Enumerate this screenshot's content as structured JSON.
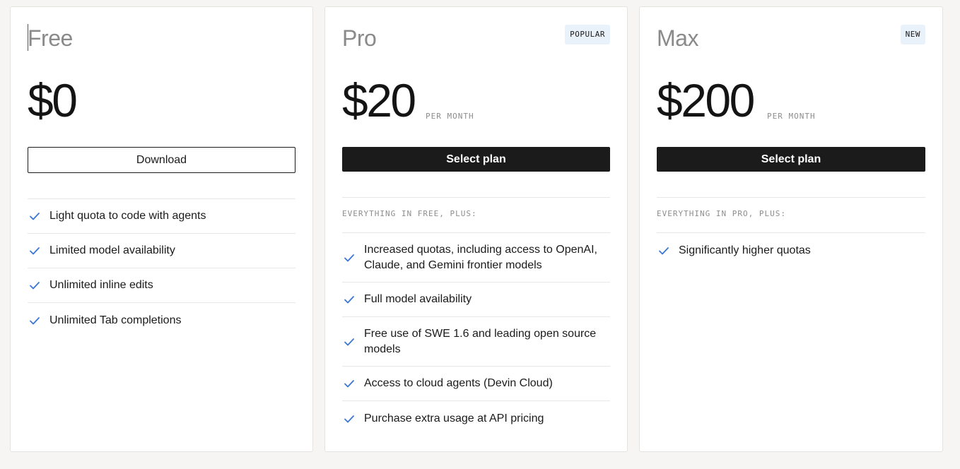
{
  "plans": {
    "free": {
      "name": "Free",
      "price": "$0",
      "button": "Download",
      "features": [
        "Light quota to code with agents",
        "Limited model availability",
        "Unlimited inline edits",
        "Unlimited Tab completions"
      ]
    },
    "pro": {
      "name": "Pro",
      "badge": "POPULAR",
      "price": "$20",
      "period": "PER MONTH",
      "button": "Select plan",
      "everything": "EVERYTHING IN FREE, PLUS:",
      "features": [
        "Increased quotas, including access to OpenAI, Claude, and Gemini frontier models",
        "Full model availability",
        "Free use of SWE 1.6 and leading open source models",
        "Access to cloud agents (Devin Cloud)",
        "Purchase extra usage at API pricing"
      ]
    },
    "max": {
      "name": "Max",
      "badge": "NEW",
      "price": "$200",
      "period": "PER MONTH",
      "button": "Select plan",
      "everything": "EVERYTHING IN PRO, PLUS:",
      "features": [
        "Significantly higher quotas"
      ]
    }
  },
  "icons": {
    "feature": "check-icon"
  },
  "colors": {
    "accent_check": "#3b76d8",
    "button_dark": "#1b1b1b",
    "badge_bg": "#e9f1fb",
    "page_bg": "#f6f5f3"
  }
}
